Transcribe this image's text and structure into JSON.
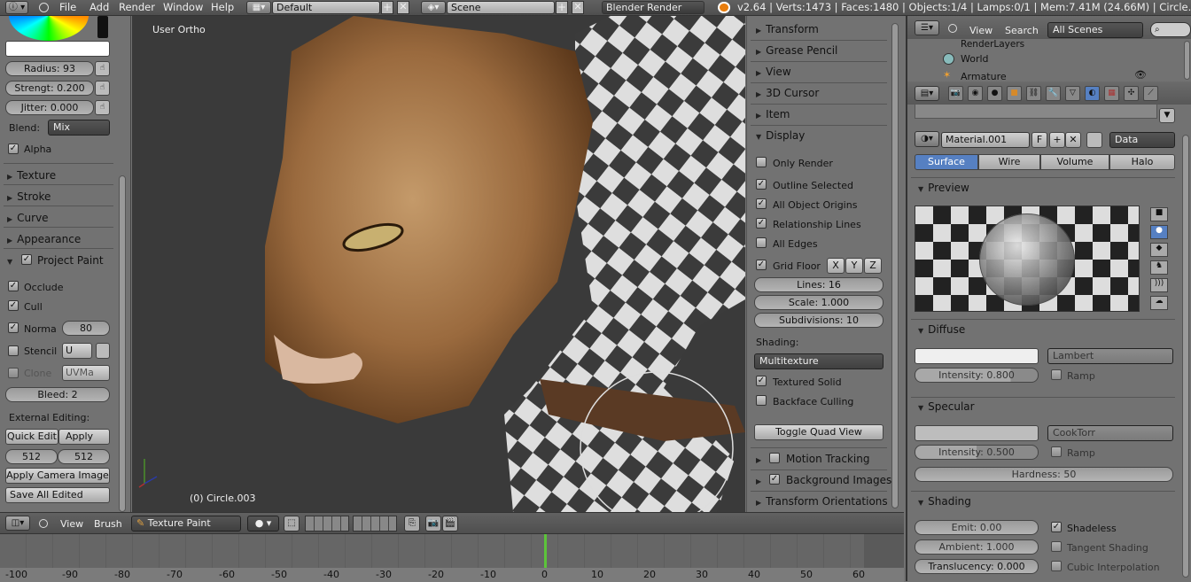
{
  "topbar": {
    "menus": [
      "File",
      "Add",
      "Render",
      "Window",
      "Help"
    ],
    "layout": "Default",
    "scene": "Scene",
    "engine": "Blender Render",
    "stats": "v2.64 | Verts:1473 | Faces:1480 | Objects:1/4 | Lamps:0/1 | Mem:7.41M (24.66M) | Circle.003"
  },
  "left": {
    "radius": "Radius: 93",
    "strength": "Strengt: 0.200",
    "jitter": "Jitter: 0.000",
    "blend_label": "Blend:",
    "blend_value": "Mix",
    "alpha": "Alpha",
    "panels": [
      "Texture",
      "Stroke",
      "Curve",
      "Appearance"
    ],
    "project_paint": "Project Paint",
    "occlude": "Occlude",
    "cull": "Cull",
    "normal": "Norma",
    "normal_value": "80",
    "stencil": "Stencil",
    "stencil_value": "U",
    "clone": "Clone",
    "clone_value": "UVMa",
    "bleed": "Bleed: 2",
    "external": "External Editing:",
    "quick_edit": "Quick Edit",
    "apply": "Apply",
    "w": "512",
    "h": "512",
    "apply_camera": "Apply Camera Image",
    "save_all": "Save All Edited"
  },
  "viewport": {
    "view_label": "User Ortho",
    "object_label": "(0) Circle.003"
  },
  "npanel": {
    "collapsed": [
      "Transform",
      "Grease Pencil",
      "View",
      "3D Cursor",
      "Item"
    ],
    "display": "Display",
    "only_render": "Only Render",
    "outline": "Outline Selected",
    "origins": "All Object Origins",
    "relationship": "Relationship Lines",
    "all_edges": "All Edges",
    "grid_floor": "Grid Floor",
    "x": "X",
    "y": "Y",
    "z": "Z",
    "lines": "Lines: 16",
    "scale": "Scale: 1.000",
    "subdiv": "Subdivisions: 10",
    "shading_label": "Shading:",
    "shading_value": "Multitexture",
    "textured_solid": "Textured Solid",
    "backface": "Backface Culling",
    "toggle_quad": "Toggle Quad View",
    "motion": "Motion Tracking",
    "background": "Background Images",
    "transform_orient": "Transform Orientations"
  },
  "outliner": {
    "view": "View",
    "search": "Search",
    "scenes": "All Scenes",
    "items": [
      "RenderLayers",
      "World",
      "Armature"
    ]
  },
  "props": {
    "material": "Material.001",
    "f": "F",
    "data": "Data",
    "tabs": [
      "Surface",
      "Wire",
      "Volume",
      "Halo"
    ],
    "preview": "Preview",
    "diffuse": "Diffuse",
    "diffuse_shader": "Lambert",
    "intensity_d": "Intensity: 0.800",
    "ramp": "Ramp",
    "specular": "Specular",
    "specular_shader": "CookTorr",
    "intensity_s": "Intensity: 0.500",
    "hardness": "Hardness: 50",
    "shading": "Shading",
    "emit": "Emit: 0.00",
    "shadeless": "Shadeless",
    "ambient": "Ambient: 1.000",
    "tangent": "Tangent Shading",
    "translucency": "Translucency: 0.000",
    "cubic": "Cubic Interpolation"
  },
  "bottom": {
    "view": "View",
    "brush": "Brush",
    "mode": "Texture Paint"
  },
  "timeline": {
    "ticks": [
      "-100",
      "-90",
      "-80",
      "-70",
      "-60",
      "-50",
      "-40",
      "-30",
      "-20",
      "-10",
      "0",
      "10",
      "20",
      "30",
      "40",
      "50",
      "60"
    ]
  },
  "colors": {
    "accent": "#5680c2",
    "frame": "#5cc43a"
  }
}
